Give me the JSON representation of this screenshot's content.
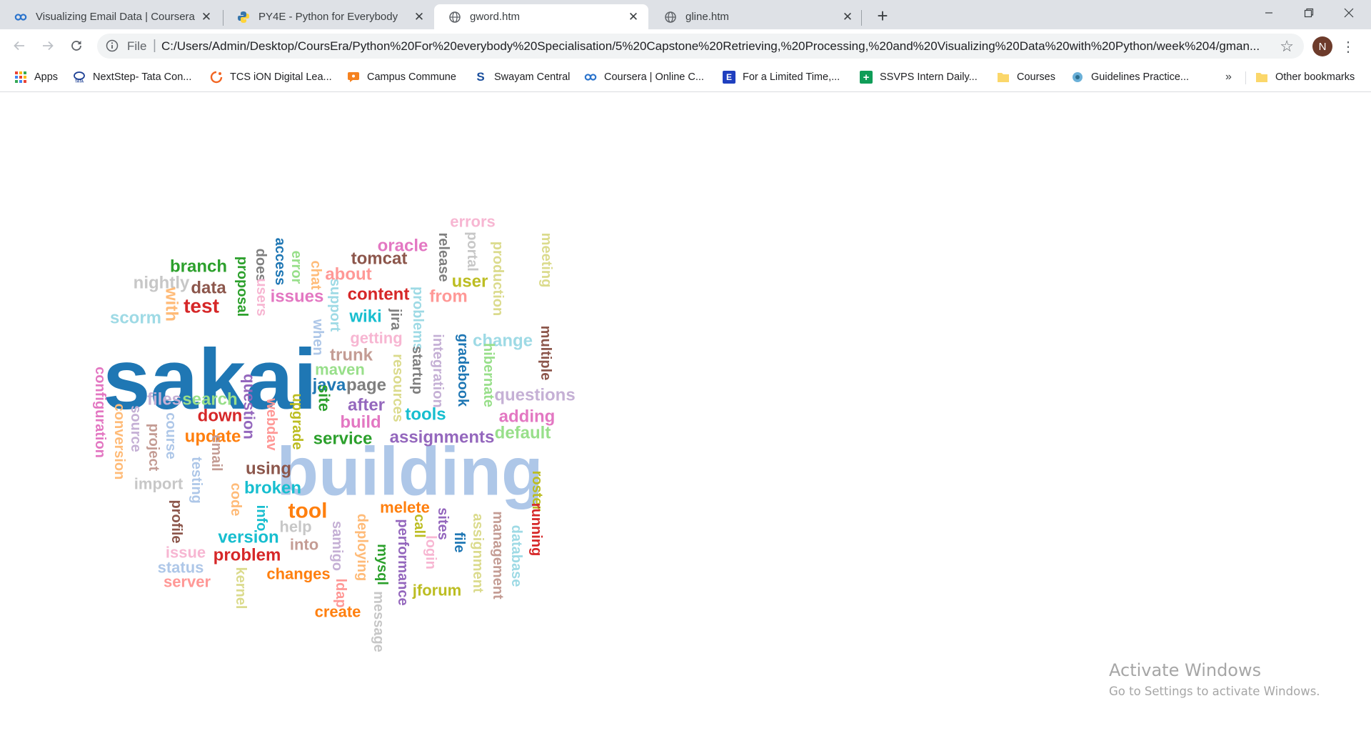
{
  "tabs": [
    {
      "title": "Visualizing Email Data | Coursera",
      "icon": "coursera-icon"
    },
    {
      "title": "PY4E - Python for Everybody",
      "icon": "python-icon"
    },
    {
      "title": "gword.htm",
      "icon": "globe-icon"
    },
    {
      "title": "gline.htm",
      "icon": "globe-icon"
    }
  ],
  "toolbar": {
    "scheme_label": "File",
    "url": "C:/Users/Admin/Desktop/CoursEra/Python%20For%20everybody%20Specialisation/5%20Capstone%20Retrieving,%20Processing,%20and%20Visualizing%20Data%20with%20Python/week%204/gman...",
    "profile_initial": "N"
  },
  "bookmarks": [
    {
      "label": "Apps",
      "icon": "apps-grid-icon"
    },
    {
      "label": "NextStep- Tata Con...",
      "icon": "tata-icon"
    },
    {
      "label": "TCS iON Digital Lea...",
      "icon": "tcs-ion-icon"
    },
    {
      "label": "Campus Commune",
      "icon": "campus-commune-icon"
    },
    {
      "label": "Swayam Central",
      "icon": "swayam-icon"
    },
    {
      "label": "Coursera | Online C...",
      "icon": "coursera-icon"
    },
    {
      "label": "For a Limited Time,...",
      "icon": "e-badge-icon"
    },
    {
      "label": "SSVPS Intern Daily...",
      "icon": "green-plus-icon"
    },
    {
      "label": "Courses",
      "icon": "folder-icon"
    },
    {
      "label": "Guidelines Practice...",
      "icon": "guidelines-icon"
    }
  ],
  "other_bookmarks": "Other bookmarks",
  "watermark": {
    "line1": "Activate Windows",
    "line2": "Go to Settings to activate Windows."
  },
  "word_cloud": [
    {
      "text": "sakai",
      "color": "#1f77b4"
    },
    {
      "text": "building",
      "color": "#aec7e8"
    },
    {
      "text": "errors",
      "color": "#f7b6d2"
    },
    {
      "text": "oracle",
      "color": "#e377c2"
    },
    {
      "text": "tomcat",
      "color": "#8c564b"
    },
    {
      "text": "branch",
      "color": "#2ca02c"
    },
    {
      "text": "nightly",
      "color": "#c7c7c7"
    },
    {
      "text": "data",
      "color": "#8c564b"
    },
    {
      "text": "with",
      "color": "#ffbb78"
    },
    {
      "text": "test",
      "color": "#d62728"
    },
    {
      "text": "scorm",
      "color": "#9edae5"
    },
    {
      "text": "about",
      "color": "#ff9896"
    },
    {
      "text": "content",
      "color": "#d62728"
    },
    {
      "text": "issues",
      "color": "#e377c2"
    },
    {
      "text": "user",
      "color": "#bcbd22"
    },
    {
      "text": "from",
      "color": "#ff9896"
    },
    {
      "text": "wiki",
      "color": "#17becf"
    },
    {
      "text": "getting",
      "color": "#f7b6d2"
    },
    {
      "text": "change",
      "color": "#9edae5"
    },
    {
      "text": "trunk",
      "color": "#c49c94"
    },
    {
      "text": "maven",
      "color": "#98df8a"
    },
    {
      "text": "java",
      "color": "#1f77b4"
    },
    {
      "text": "page",
      "color": "#7f7f7f"
    },
    {
      "text": "questions",
      "color": "#c5b0d5"
    },
    {
      "text": "files",
      "color": "#c5b0d5"
    },
    {
      "text": "search",
      "color": "#98df8a"
    },
    {
      "text": "down",
      "color": "#d62728"
    },
    {
      "text": "after",
      "color": "#9467bd"
    },
    {
      "text": "tools",
      "color": "#17becf"
    },
    {
      "text": "adding",
      "color": "#e377c2"
    },
    {
      "text": "build",
      "color": "#e377c2"
    },
    {
      "text": "default",
      "color": "#98df8a"
    },
    {
      "text": "update",
      "color": "#ff7f0e"
    },
    {
      "text": "service",
      "color": "#2ca02c"
    },
    {
      "text": "assignments",
      "color": "#9467bd"
    },
    {
      "text": "using",
      "color": "#8c564b"
    },
    {
      "text": "import",
      "color": "#c7c7c7"
    },
    {
      "text": "broken",
      "color": "#17becf"
    },
    {
      "text": "tool",
      "color": "#ff7f0e"
    },
    {
      "text": "melete",
      "color": "#ff7f0e"
    },
    {
      "text": "help",
      "color": "#c7c7c7"
    },
    {
      "text": "version",
      "color": "#17becf"
    },
    {
      "text": "into",
      "color": "#c49c94"
    },
    {
      "text": "issue",
      "color": "#f7b6d2"
    },
    {
      "text": "problem",
      "color": "#d62728"
    },
    {
      "text": "status",
      "color": "#aec7e8"
    },
    {
      "text": "server",
      "color": "#ff9896"
    },
    {
      "text": "changes",
      "color": "#ff7f0e"
    },
    {
      "text": "jforum",
      "color": "#bcbd22"
    },
    {
      "text": "create",
      "color": "#ff7f0e"
    },
    {
      "text": "access",
      "color": "#1f77b4"
    },
    {
      "text": "error",
      "color": "#98df8a"
    },
    {
      "text": "does",
      "color": "#7f7f7f"
    },
    {
      "text": "proposal",
      "color": "#2ca02c"
    },
    {
      "text": "users",
      "color": "#f7b6d2"
    },
    {
      "text": "chat",
      "color": "#ffbb78"
    },
    {
      "text": "support",
      "color": "#9edae5"
    },
    {
      "text": "when",
      "color": "#aec7e8"
    },
    {
      "text": "release",
      "color": "#7f7f7f"
    },
    {
      "text": "portal",
      "color": "#c7c7c7"
    },
    {
      "text": "production",
      "color": "#dbdb8d"
    },
    {
      "text": "meeting",
      "color": "#dbdb8d"
    },
    {
      "text": "jira",
      "color": "#7f7f7f"
    },
    {
      "text": "problems",
      "color": "#9edae5"
    },
    {
      "text": "resources",
      "color": "#dbdb8d"
    },
    {
      "text": "startup",
      "color": "#7f7f7f"
    },
    {
      "text": "integration",
      "color": "#c5b0d5"
    },
    {
      "text": "gradebook",
      "color": "#1f77b4"
    },
    {
      "text": "hibernate",
      "color": "#98df8a"
    },
    {
      "text": "multiple",
      "color": "#8c564b"
    },
    {
      "text": "configuration",
      "color": "#e377c2"
    },
    {
      "text": "conversion",
      "color": "#ffbb78"
    },
    {
      "text": "source",
      "color": "#c5b0d5"
    },
    {
      "text": "project",
      "color": "#c49c94"
    },
    {
      "text": "course",
      "color": "#aec7e8"
    },
    {
      "text": "email",
      "color": "#c49c94"
    },
    {
      "text": "testing",
      "color": "#aec7e8"
    },
    {
      "text": "code",
      "color": "#ffbb78"
    },
    {
      "text": "profile",
      "color": "#8c564b"
    },
    {
      "text": "info",
      "color": "#17becf"
    },
    {
      "text": "question",
      "color": "#9467bd"
    },
    {
      "text": "webdav",
      "color": "#ff9896"
    },
    {
      "text": "upgrade",
      "color": "#bcbd22"
    },
    {
      "text": "site",
      "color": "#2ca02c"
    },
    {
      "text": "samigo",
      "color": "#c5b0d5"
    },
    {
      "text": "deploying",
      "color": "#ffbb78"
    },
    {
      "text": "ldap",
      "color": "#ff9896"
    },
    {
      "text": "kernel",
      "color": "#dbdb8d"
    },
    {
      "text": "mysql",
      "color": "#2ca02c"
    },
    {
      "text": "message",
      "color": "#c7c7c7"
    },
    {
      "text": "performance",
      "color": "#9467bd"
    },
    {
      "text": "call",
      "color": "#bcbd22"
    },
    {
      "text": "sites",
      "color": "#9467bd"
    },
    {
      "text": "login",
      "color": "#f7b6d2"
    },
    {
      "text": "file",
      "color": "#1f77b4"
    },
    {
      "text": "assignment",
      "color": "#dbdb8d"
    },
    {
      "text": "management",
      "color": "#c49c94"
    },
    {
      "text": "database",
      "color": "#9edae5"
    },
    {
      "text": "roster",
      "color": "#bcbd22"
    },
    {
      "text": "running",
      "color": "#d62728"
    }
  ]
}
